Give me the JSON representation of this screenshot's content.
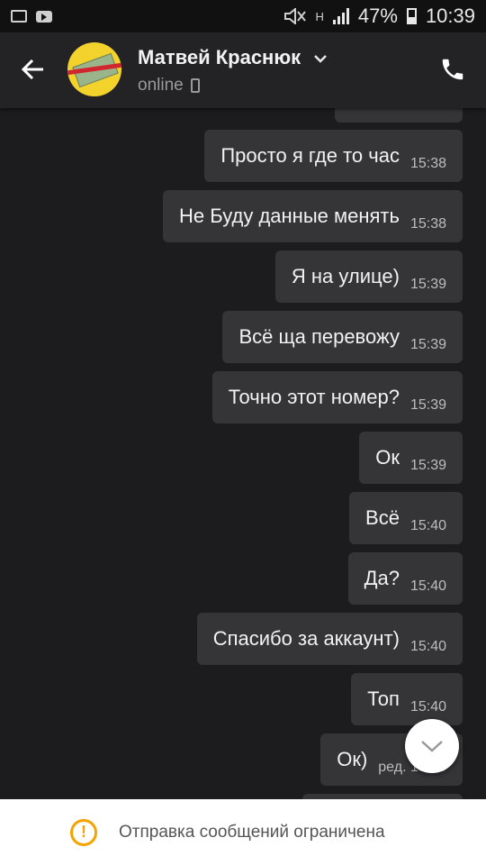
{
  "status_bar": {
    "icons_left": [
      "gallery-icon",
      "youtube-icon"
    ],
    "icons_right": [
      "mute-icon",
      "h-network-icon",
      "signal-icon",
      "battery-icon"
    ],
    "network_label": "H",
    "battery": "47%",
    "time": "10:39"
  },
  "header": {
    "contact_name": "Матвей Краснюк",
    "status": "online",
    "back_icon": "arrow-left-icon",
    "call_icon": "phone-icon"
  },
  "messages": [
    {
      "text": "Просто я где то час",
      "time": "15:38"
    },
    {
      "text": "Не Буду данные менять",
      "time": "15:38"
    },
    {
      "text": "Я на улице)",
      "time": "15:39"
    },
    {
      "text": "Всё ща перевожу",
      "time": "15:39"
    },
    {
      "text": "Точно этот номер?",
      "time": "15:39"
    },
    {
      "text": "Ок",
      "time": "15:39"
    },
    {
      "text": "Всё",
      "time": "15:40"
    },
    {
      "text": "Да?",
      "time": "15:40"
    },
    {
      "text": "Спасибо за аккаунт)",
      "time": "15:40"
    },
    {
      "text": "Топ",
      "time": "15:40"
    },
    {
      "text": "Ок)",
      "time": "ред. 15:40"
    }
  ],
  "scroll_button_icon": "chevron-down-icon",
  "footer": {
    "warning_icon": "exclamation-icon",
    "warning_mark": "!",
    "text": "Отправка сообщений ограничена"
  },
  "colors": {
    "background": "#1c1c1e",
    "bubble": "#353537",
    "header": "#232325",
    "warning": "#f5a300"
  }
}
